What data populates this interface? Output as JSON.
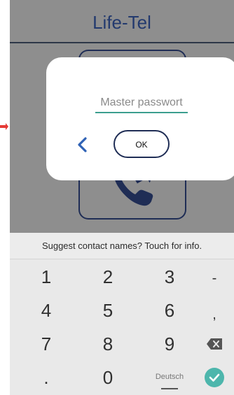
{
  "app": {
    "title": "Life-Tel",
    "colors": {
      "background": "#8e8e8e",
      "accent": "#233a6e",
      "input_underline": "#3c9e8f",
      "back_arrow": "#2f62b5"
    }
  },
  "dialog": {
    "password_placeholder": "Master passwort",
    "password_value": "",
    "ok_label": "OK",
    "back_icon": "chevron-left-icon"
  },
  "keyboard": {
    "suggestion": "Suggest contact names? Touch for info.",
    "rows": [
      [
        "1",
        "2",
        "3",
        "-"
      ],
      [
        "4",
        "5",
        "6",
        ","
      ],
      [
        "7",
        "8",
        "9"
      ],
      [
        ".",
        "0",
        "Deutsch"
      ]
    ],
    "backspace_icon": "backspace-icon",
    "enter_icon": "check-icon",
    "enter_color": "#4db6ac"
  }
}
